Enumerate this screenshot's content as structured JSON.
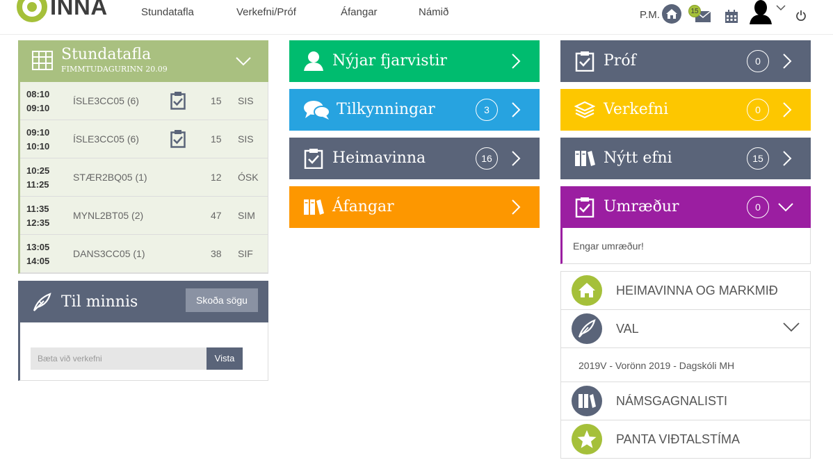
{
  "app": {
    "logo_text": "INNA"
  },
  "nav": {
    "items": [
      "Stundatafla",
      "Verkefni/Próf",
      "Áfangar",
      "Námið"
    ]
  },
  "header": {
    "pm_label": "P.M.",
    "mail_count": "15"
  },
  "timetable": {
    "title": "Stundatafla",
    "subtitle": "FIMMTUDAGURINN 20.09",
    "rows": [
      {
        "start": "08:10",
        "end": "09:10",
        "course": "ÍSLE3CC05 (6)",
        "room": "15",
        "teacher": "SIS",
        "has_assignment": true
      },
      {
        "start": "09:10",
        "end": "10:10",
        "course": "ÍSLE3CC05 (6)",
        "room": "15",
        "teacher": "SIS",
        "has_assignment": true
      },
      {
        "start": "10:25",
        "end": "11:25",
        "course": "STÆR2BQ05 (1)",
        "room": "12",
        "teacher": "ÓSK",
        "has_assignment": false
      },
      {
        "start": "11:35",
        "end": "12:35",
        "course": "MYNL2BT05 (2)",
        "room": "47",
        "teacher": "SIM",
        "has_assignment": false
      },
      {
        "start": "13:05",
        "end": "14:05",
        "course": "DANS3CC05 (1)",
        "room": "38",
        "teacher": "SIF",
        "has_assignment": false
      }
    ]
  },
  "reminders": {
    "title": "Til minnis",
    "history_button": "Skoða sögu",
    "input_placeholder": "Bæta við verkefni",
    "save_button": "Vista"
  },
  "tiles": {
    "absences": {
      "label": "Nýjar fjarvistir",
      "color": "#00bc6f"
    },
    "announcements": {
      "label": "Tilkynningar",
      "count": "3",
      "color": "#27a3e0"
    },
    "homework": {
      "label": "Heimavinna",
      "count": "16",
      "color": "#5a6479"
    },
    "courses": {
      "label": "Áfangar",
      "color": "#fd9700"
    },
    "exams": {
      "label": "Próf",
      "count": "0",
      "color": "#5a6479"
    },
    "assignments": {
      "label": "Verkefni",
      "count": "0",
      "color": "#fdc700"
    },
    "new_material": {
      "label": "Nýtt efni",
      "count": "15",
      "color": "#5a6479"
    },
    "discussions": {
      "label": "Umræður",
      "count": "0",
      "color": "#9b1ea1",
      "empty_text": "Engar umræður!"
    }
  },
  "links": {
    "homework_goals": {
      "label": "HEIMAVINNA OG MARKMIÐ",
      "icon": "home-icon",
      "color": "#a5c03a"
    },
    "electives": {
      "label": "VAL",
      "icon": "quill-icon",
      "color": "#5a6479",
      "semester": "2019V - Vorönn 2019 - Dagskóli MH"
    },
    "material_list": {
      "label": "NÁMSGAGNALISTI",
      "icon": "books-icon",
      "color": "#5a6479"
    },
    "book_interview": {
      "label": "PANTA VIÐTALSTÍMA",
      "icon": "star-icon",
      "color": "#a5c03a"
    }
  }
}
